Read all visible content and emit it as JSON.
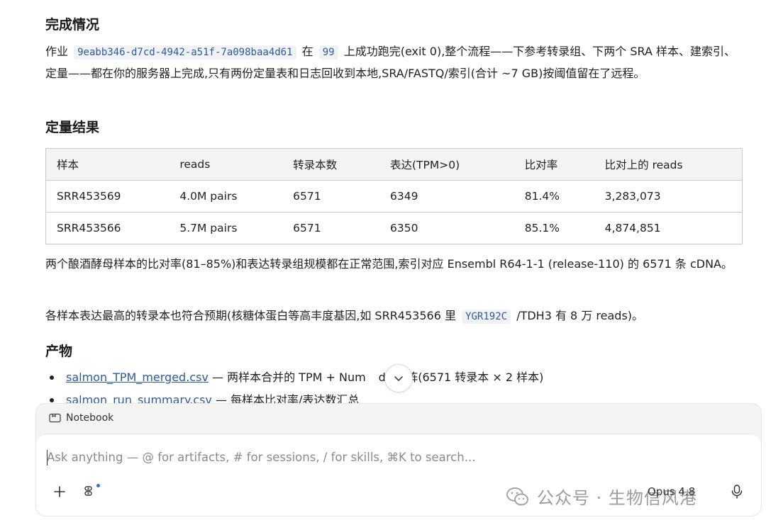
{
  "sections": {
    "completion_title": "完成情况",
    "quant_title": "定量结果",
    "products_title": "产物"
  },
  "completion": {
    "prefix": "作业",
    "job_id": "9eabb346-d7cd-4942-a51f-7a098baa4d61",
    "mid": "在",
    "server_id": "99",
    "suffix": "上成功跑完(exit 0),整个流程——下参考转录组、下两个 SRA 样本、建索引、定量——都在你的服务器上完成,只有两份定量表和日志回收到本地,SRA/FASTQ/索引(合计 ~7 GB)按阈值留在了远程。"
  },
  "table": {
    "headers": [
      "样本",
      "reads",
      "转录本数",
      "表达(TPM>0)",
      "比对率",
      "比对上的 reads"
    ],
    "rows": [
      [
        "SRR453569",
        "4.0M pairs",
        "6571",
        "6349",
        "81.4%",
        "3,283,073"
      ],
      [
        "SRR453566",
        "5.7M pairs",
        "6571",
        "6350",
        "85.1%",
        "4,874,851"
      ]
    ]
  },
  "summary": {
    "p1": "两个酿酒酵母样本的比对率(81–85%)和表达转录组规模都在正常范围,索引对应 Ensembl R64-1-1 (release-110) 的 6571 条 cDNA。",
    "p2_prefix": "各样本表达最高的转录本也符合预期(核糖体蛋白等高丰度基因,如 SRR453566 里",
    "p2_code": "YGR192C",
    "p2_suffix": "/TDH3 有 8 万 reads)。"
  },
  "products": [
    {
      "file": "salmon_TPM_merged.csv",
      "desc": " — 两样本合并的 TPM + Num",
      "desc_tail": "ds 矩阵(6571 转录本 × 2 样本)"
    },
    {
      "file": "salmon_run_summary.csv",
      "desc": " — 每样本比对率/表达数汇总",
      "desc_tail": ""
    }
  ],
  "composer": {
    "notebook_label": "Notebook",
    "placeholder": "Ask anything — @ for artifacts, # for sessions, / for skills, ⌘K to search...",
    "model_label": "Opus 4.8",
    "watermark_text": "公众号 · 生物信风港"
  },
  "icons": {
    "scroll": "chevron-down-icon",
    "notebook": "notebook-icon",
    "plus": "plus-icon",
    "tools": "tools-icon",
    "mic": "mic-icon",
    "wechat": "wechat-icon"
  },
  "colors": {
    "link": "#2d5a9e",
    "code_bg": "#f0f2f5",
    "accent_dot": "#3b6fd6"
  }
}
